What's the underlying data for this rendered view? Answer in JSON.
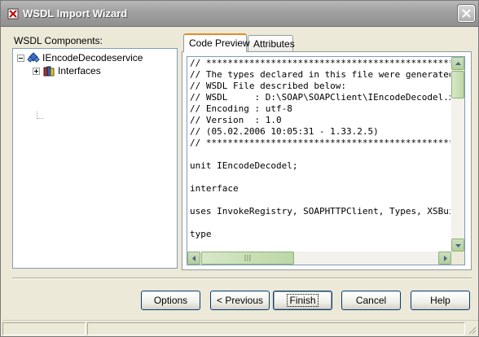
{
  "window": {
    "title": "WSDL Import Wizard",
    "close_label": "✕"
  },
  "tree": {
    "group_label": "WSDL Components:",
    "root": {
      "label": "IEncodeDecodeservice"
    },
    "child": {
      "label": "Interfaces"
    }
  },
  "tabs": [
    {
      "label": "Code Preview",
      "active": true
    },
    {
      "label": "Attributes",
      "active": false
    }
  ],
  "code_preview": {
    "lines": [
      "// ********************************************************************* //",
      "// The types declared in this file were generated from data read from the",
      "// WSDL File described below:",
      "// WSDL     : D:\\SOAP\\SOAPClient\\IEncodeDecodel.xml",
      "// Encoding : utf-8",
      "// Version  : 1.0",
      "// (05.02.2006 10:05:31 - 1.33.2.5)",
      "// ********************************************************************* //",
      "",
      "unit IEncodeDecodel;",
      "",
      "interface",
      "",
      "uses InvokeRegistry, SOAPHTTPClient, Types, XSBuiltIns;",
      "",
      "type"
    ]
  },
  "buttons": {
    "options": "Options",
    "previous": "< Previous",
    "finish": "Finish",
    "cancel": "Cancel",
    "help": "Help"
  },
  "colors": {
    "window_bg": "#ece9d8",
    "title_bar": "#a0a0a0",
    "tab_accent": "#e68b2c",
    "scrollbar": "#b2cf9e"
  }
}
